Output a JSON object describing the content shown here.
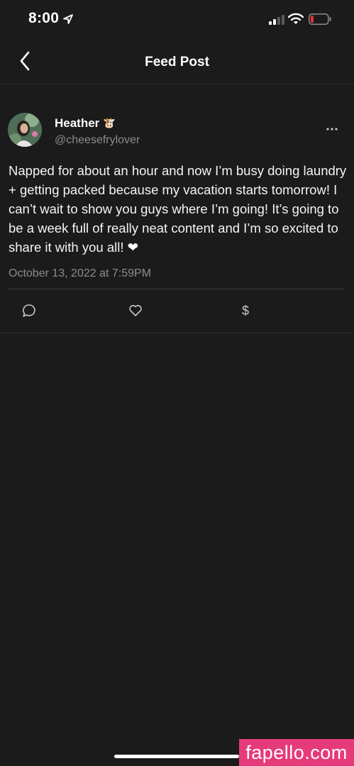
{
  "status_bar": {
    "time": "8:00"
  },
  "nav": {
    "title": "Feed Post"
  },
  "post": {
    "author_name": "Heather",
    "author_emoji": "🐮",
    "author_handle": "@cheesefrylover",
    "text": "Napped for about an hour and now I’m busy doing laundry + getting packed because my vacation starts tomorrow! I can’t wait to show you guys where I’m going! It’s going to be a week full of really neat content and I’m so excited to share it with you all!",
    "text_emoji": "❤",
    "date": "October 13, 2022 at 7:59PM"
  },
  "actions": {
    "tip_symbol": "$"
  },
  "watermark": "fapello.com",
  "icons": {
    "location": "location-arrow-icon",
    "signal": "cellular-signal-icon",
    "wifi": "wifi-icon",
    "battery": "battery-low-icon",
    "back": "chevron-left-icon",
    "more": "ellipsis-icon",
    "comment": "comment-icon",
    "like": "heart-icon",
    "tip": "dollar-icon"
  },
  "colors": {
    "background": "#1b1b1c",
    "battery_low": "#e5312f",
    "watermark": "#e63b7a"
  }
}
